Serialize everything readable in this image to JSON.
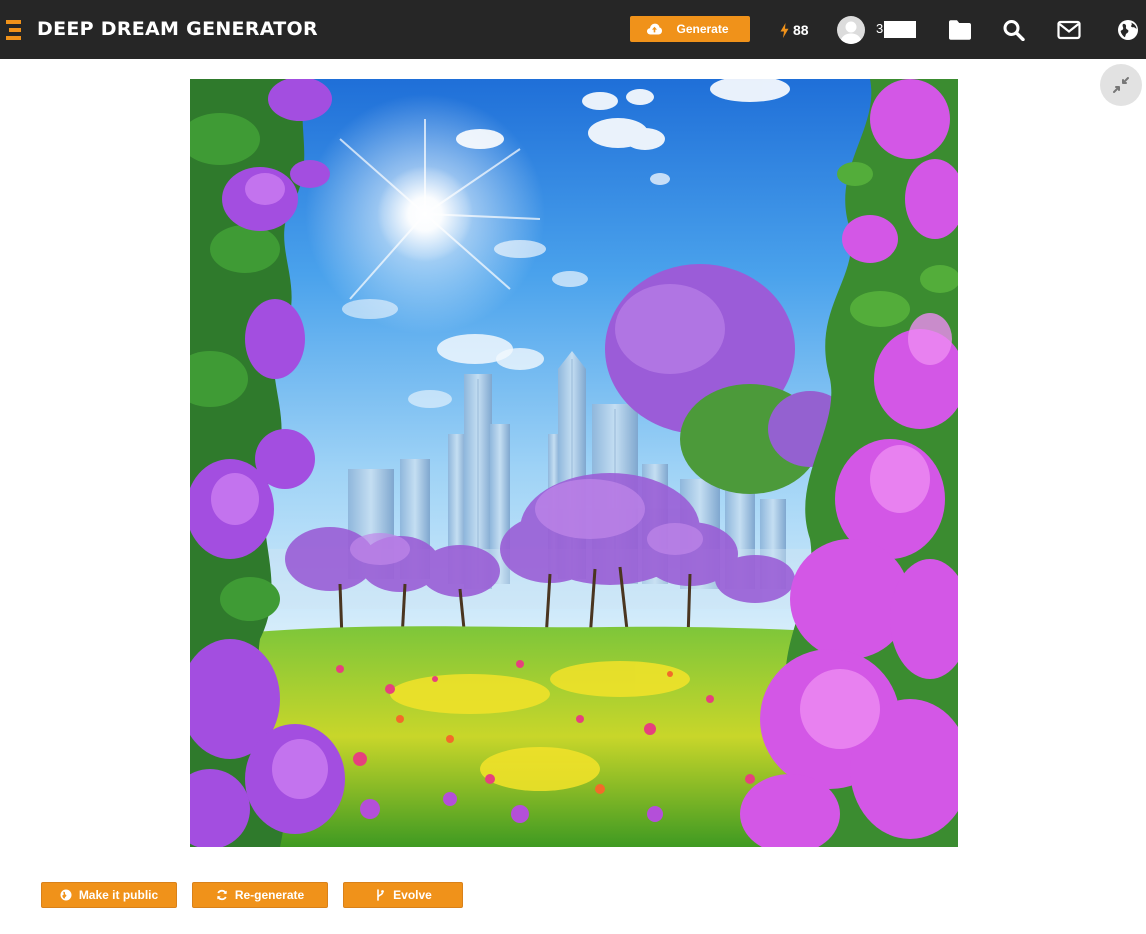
{
  "header": {
    "brand": "DEEP DREAM GENERATOR",
    "generate_label": "Generate",
    "credits": "88",
    "username": "3",
    "icons": [
      "folder-icon",
      "search-icon",
      "mail-icon",
      "globe-icon"
    ]
  },
  "actions": {
    "make_public_label": "Make it public",
    "regenerate_label": "Re-generate",
    "evolve_label": "Evolve"
  },
  "colors": {
    "accent": "#f0921a",
    "topbar": "#262626",
    "collapse_button": "#e2e2e2"
  }
}
